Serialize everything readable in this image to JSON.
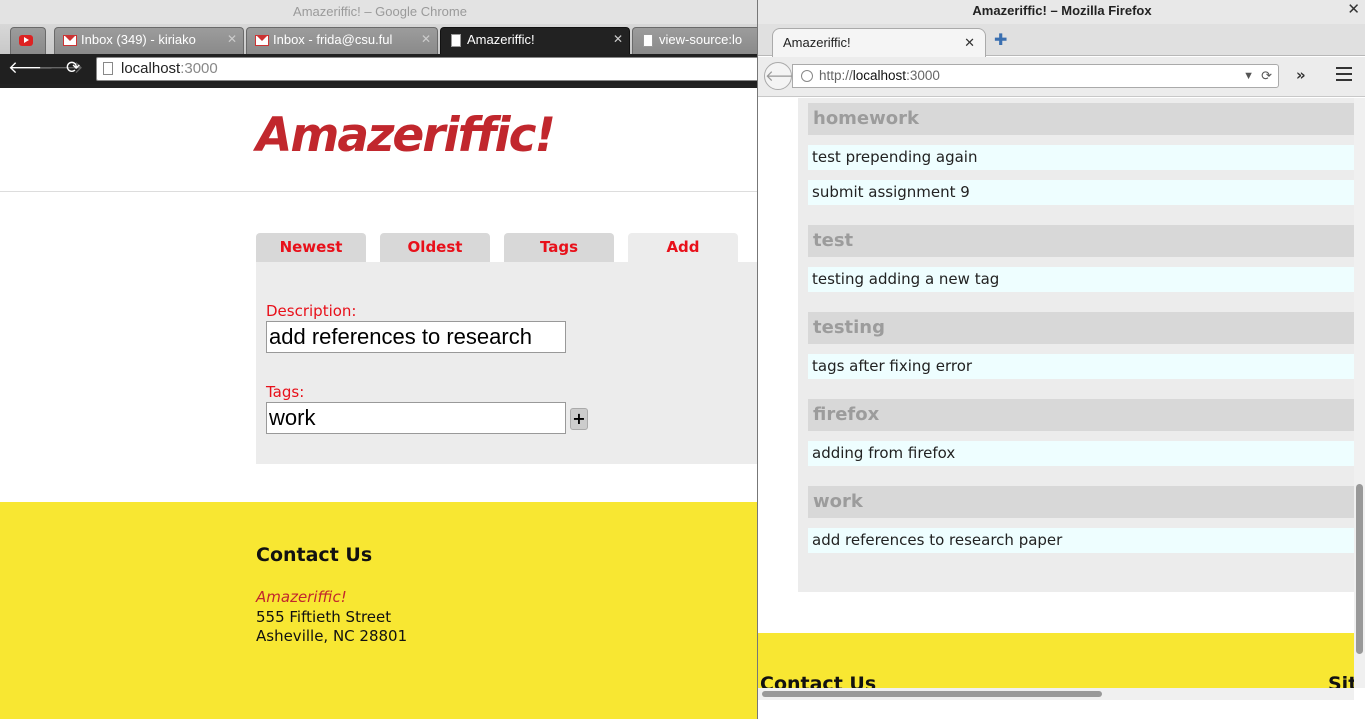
{
  "chrome": {
    "title": "Amazeriffic! – Google Chrome",
    "tabs": [
      {
        "label": "",
        "icon": "youtube-icon"
      },
      {
        "label": "Inbox (349) - kiriako",
        "icon": "gmail-icon"
      },
      {
        "label": "Inbox - frida@csu.ful",
        "icon": "gmail-icon"
      },
      {
        "label": "Amazeriffic!",
        "icon": "page-icon"
      },
      {
        "label": "view-source:lo",
        "icon": "page-icon"
      }
    ],
    "url_host": "localhost",
    "url_port": ":3000"
  },
  "app": {
    "logo": "Amazeriffic!",
    "tabs": [
      "Newest",
      "Oldest",
      "Tags",
      "Add"
    ],
    "active_tab": "Add",
    "form": {
      "description_label": "Description:",
      "description_value": "add references to research",
      "tags_label": "Tags:",
      "tags_value": "work",
      "add_button": "+"
    },
    "footer": {
      "title": "Contact Us",
      "brand": "Amazeriffic!",
      "address_line1": "555 Fiftieth Street",
      "address_line2": "Asheville, NC 28801"
    }
  },
  "firefox": {
    "title": "Amazeriffic! – Mozilla Firefox",
    "tab_label": "Amazeriffic!",
    "url_scheme": "http://",
    "url_host": "localhost",
    "url_port": ":3000",
    "tag_groups": [
      {
        "tag": "homework",
        "items": [
          "test prepending again",
          "submit assignment 9"
        ]
      },
      {
        "tag": "test",
        "items": [
          "testing adding a new tag"
        ]
      },
      {
        "tag": "testing",
        "items": [
          "tags after fixing error"
        ]
      },
      {
        "tag": "firefox",
        "items": [
          "adding from firefox"
        ]
      },
      {
        "tag": "work",
        "items": [
          "add references to research paper"
        ]
      }
    ],
    "footer_title": "Contact Us",
    "footer_right": "Sit"
  },
  "colors": {
    "brand_red": "#c1272d",
    "tab_text_red": "#e8101a",
    "footer_yellow": "#f8e732",
    "todo_bg": "#eefeff"
  }
}
